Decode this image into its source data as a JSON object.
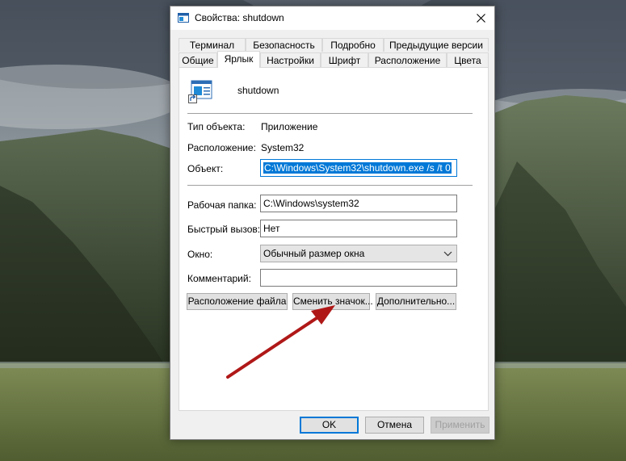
{
  "window": {
    "title": "Свойства: shutdown",
    "close_icon": "close-icon"
  },
  "tabs_top": [
    {
      "label": "Терминал"
    },
    {
      "label": "Безопасность"
    },
    {
      "label": "Подробно"
    },
    {
      "label": "Предыдущие версии"
    }
  ],
  "tabs_bottom": [
    {
      "label": "Общие"
    },
    {
      "label": "Ярлык",
      "active": true
    },
    {
      "label": "Настройки"
    },
    {
      "label": "Шрифт"
    },
    {
      "label": "Расположение"
    },
    {
      "label": "Цвета"
    }
  ],
  "shortcut": {
    "name": "shutdown",
    "icon": "shortcut-icon",
    "type_label": "Тип объекта:",
    "type_value": "Приложение",
    "location_label": "Расположение:",
    "location_value": "System32",
    "target_label": "Объект:",
    "target_value": "C:\\Windows\\System32\\shutdown.exe /s /t 0",
    "workdir_label": "Рабочая папка:",
    "workdir_value": "C:\\Windows\\system32",
    "hotkey_label": "Быстрый вызов:",
    "hotkey_value": "Нет",
    "window_label": "Окно:",
    "window_value": "Обычный размер окна",
    "comment_label": "Комментарий:",
    "comment_value": ""
  },
  "buttons": {
    "open_location": "Расположение файла",
    "change_icon": "Сменить значок...",
    "advanced": "Дополнительно...",
    "ok": "OK",
    "cancel": "Отмена",
    "apply": "Применить"
  },
  "colors": {
    "accent": "#0078d7",
    "annotation_arrow": "#b01818"
  }
}
